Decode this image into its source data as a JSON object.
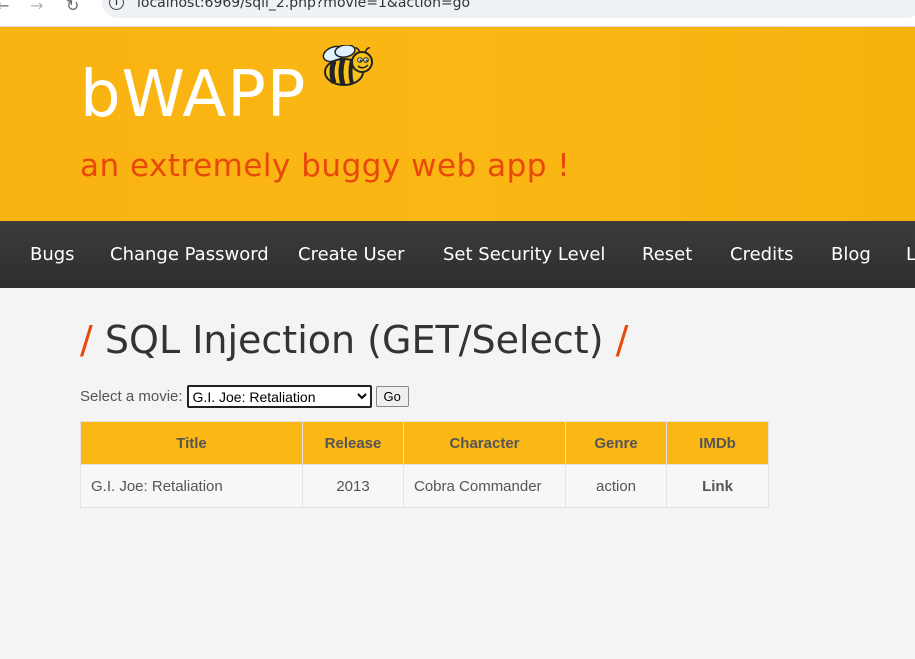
{
  "browser": {
    "url": "localhost:6969/sqli_2.php?movie=1&action=go"
  },
  "header": {
    "logo": "bWAPP",
    "tagline": "an extremely buggy web app !"
  },
  "menu": {
    "items": [
      "Bugs",
      "Change Password",
      "Create User",
      "Set Security Level",
      "Reset",
      "Credits",
      "Blog",
      "L"
    ]
  },
  "page": {
    "title": "SQL Injection (GET/Select)",
    "select_label": "Select a movie:",
    "selected_movie": "G.I. Joe: Retaliation",
    "go_label": "Go"
  },
  "table": {
    "headers": [
      "Title",
      "Release",
      "Character",
      "Genre",
      "IMDb"
    ],
    "rows": [
      [
        "G.I. Joe: Retaliation",
        "2013",
        "Cobra Commander",
        "action",
        "Link"
      ]
    ]
  },
  "colors": {
    "header_bg": "#fbb714",
    "accent": "#e8480a",
    "menu_bg": "#333333"
  }
}
